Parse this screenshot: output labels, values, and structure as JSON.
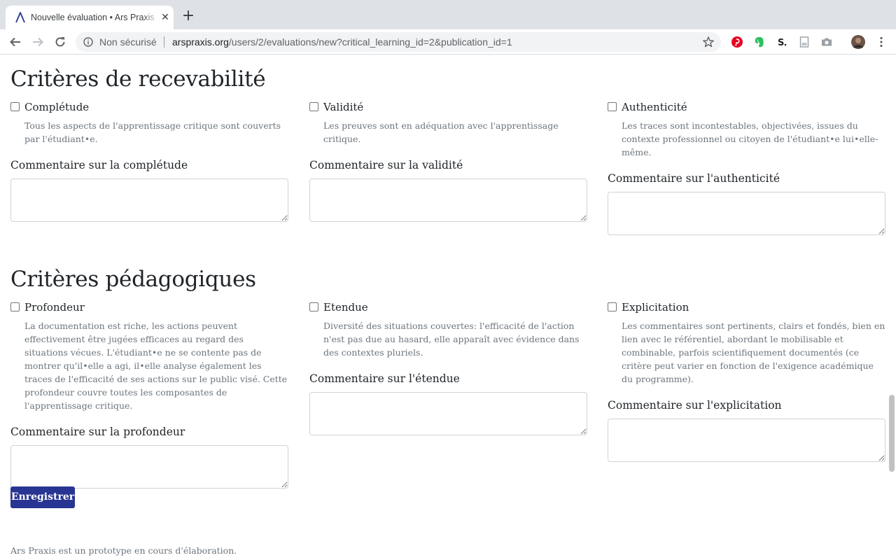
{
  "browser": {
    "tab_title": "Nouvelle évaluation • Ars Praxis",
    "close_glyph": "✕",
    "new_tab_glyph": "+",
    "security_label": "Non sécurisé",
    "url_host": "arspraxis.org",
    "url_path": "/users/2/evaluations/new?critical_learning_id=2&publication_id=1",
    "extensions": [
      "pinterest-icon",
      "evernote-icon",
      "stylebot-icon",
      "page-icon",
      "camera-icon",
      "avatar"
    ]
  },
  "form": {
    "sections": [
      {
        "title": "Critères de recevabilité",
        "criteria": [
          {
            "label": "Complétude",
            "checked": false,
            "help": "Tous les aspects de l'apprentissage critique sont couverts par l'étudiant•e.",
            "comment_label": "Commentaire sur la complétude"
          },
          {
            "label": "Validité",
            "checked": false,
            "help": "Les preuves sont en adéquation avec l'apprentissage critique.",
            "comment_label": "Commentaire sur la validité"
          },
          {
            "label": "Authenticité",
            "checked": false,
            "help": "Les traces sont incontestables, objectivées, issues du contexte professionnel ou citoyen de l'étudiant•e lui•elle-même.",
            "comment_label": "Commentaire sur l'authenticité"
          }
        ]
      },
      {
        "title": "Critères pédagogiques",
        "criteria": [
          {
            "label": "Profondeur",
            "checked": false,
            "help": "La documentation est riche, les actions peuvent effectivement être jugées efficaces au regard des situations vécues. L'étudiant•e ne se contente pas de montrer qu'il•elle a agi, il•elle analyse également les traces de l'efficacité de ses actions sur le public visé. Cette profondeur couvre toutes les composantes de l'apprentissage critique.",
            "comment_label": "Commentaire sur la profondeur"
          },
          {
            "label": "Etendue",
            "checked": false,
            "help": "Diversité des situations couvertes: l'efficacité de l'action n'est pas due au hasard, elle apparaît avec évidence dans des contextes pluriels.",
            "comment_label": "Commentaire sur l'étendue"
          },
          {
            "label": "Explicitation",
            "checked": false,
            "help": "Les commentaires sont pertinents, clairs et fondés, bien en lien avec le référentiel, abordant le mobilisable et combinable, parfois scientifiquement documentés (ce critère peut varier en fonction de l'exigence académique du programme).",
            "comment_label": "Commentaire sur l'explicitation"
          }
        ]
      }
    ],
    "submit_label": "Enregistrer"
  },
  "footer": {
    "note": "Ars Praxis est un prototype en cours d'élaboration."
  },
  "colors": {
    "submit_button": "#283593",
    "help_text": "#6c757d",
    "tab_strip": "#dee1e6"
  }
}
